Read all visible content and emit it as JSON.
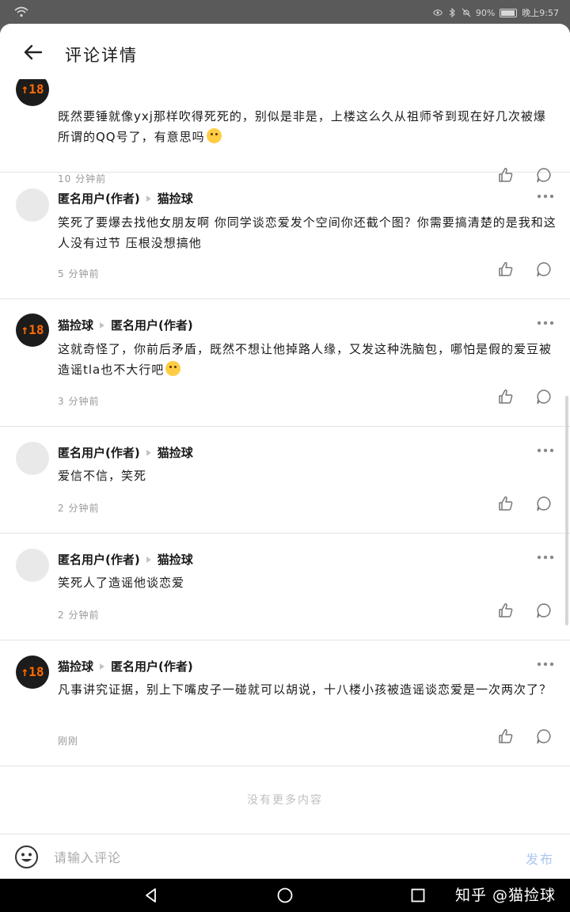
{
  "status_bar": {
    "battery": "90%",
    "time": "晚上9:57"
  },
  "header": {
    "title": "评论详情"
  },
  "comments": [
    {
      "avatar": "cat",
      "author": "",
      "reply_to": "",
      "text": "既然要锤就像yxj那样吹得死死的，别似是非是，上楼这么久从祖师爷到现在好几次被爆所谓的QQ号了，有意思吗",
      "has_emoji": true,
      "time": "10 分钟前"
    },
    {
      "avatar": "anon",
      "author": "匿名用户(作者)",
      "reply_to": "猫捡球",
      "text": "笑死了要爆去找他女朋友啊 你同学谈恋爱发个空间你还截个图？你需要搞清楚的是我和这人没有过节 压根没想搞他",
      "has_emoji": false,
      "time": "5 分钟前"
    },
    {
      "avatar": "cat",
      "author": "猫捡球",
      "reply_to": "匿名用户(作者)",
      "text": "这就奇怪了，你前后矛盾，既然不想让他掉路人缘，又发这种洗脑包，哪怕是假的爱豆被造谣tla也不大行吧",
      "has_emoji": true,
      "time": "3 分钟前"
    },
    {
      "avatar": "anon",
      "author": "匿名用户(作者)",
      "reply_to": "猫捡球",
      "text": "爱信不信，笑死",
      "has_emoji": false,
      "time": "2 分钟前"
    },
    {
      "avatar": "anon",
      "author": "匿名用户(作者)",
      "reply_to": "猫捡球",
      "text": "笑死人了造谣他谈恋爱",
      "has_emoji": false,
      "time": "2 分钟前"
    },
    {
      "avatar": "cat",
      "author": "猫捡球",
      "reply_to": "匿名用户(作者)",
      "text": "凡事讲究证据，别上下嘴皮子一碰就可以胡说，十八楼小孩被造谣谈恋爱是一次两次了？",
      "has_emoji": false,
      "time": "刚刚"
    }
  ],
  "avatar_badge": "↑18",
  "no_more": "没有更多内容",
  "input": {
    "placeholder": "请输入评论",
    "send_label": "发布"
  },
  "watermark": "知乎 @猫捡球",
  "colors": {
    "accent_disabled": "#a9c6ee",
    "badge": "#ff6a00"
  }
}
